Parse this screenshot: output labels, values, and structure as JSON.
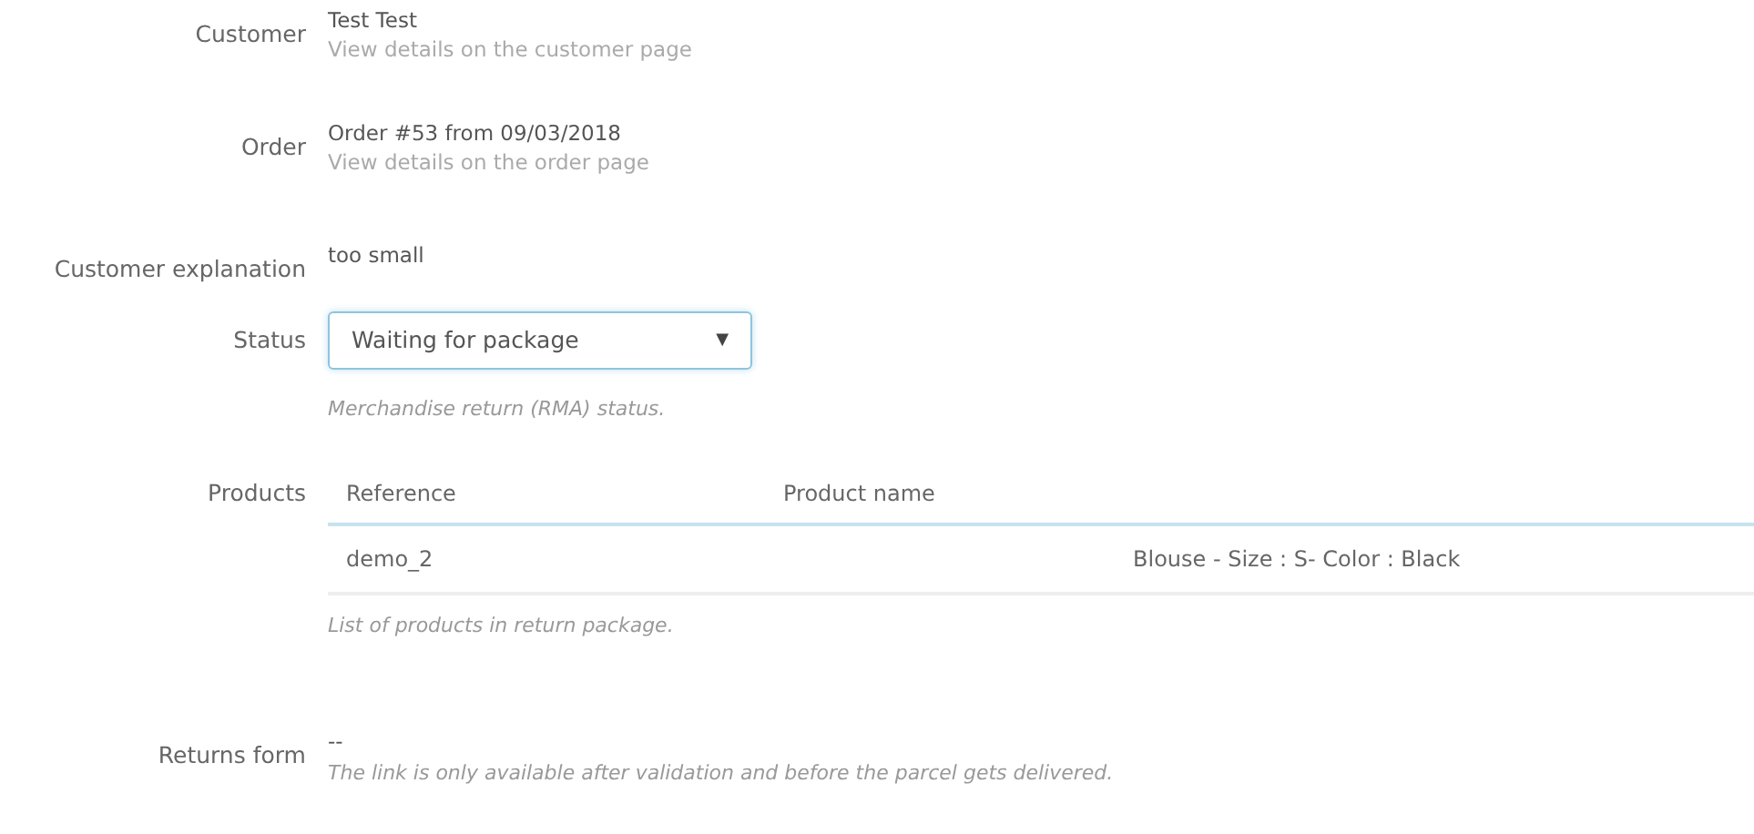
{
  "customer": {
    "label": "Customer",
    "name": "Test Test",
    "link": "View details on the customer page"
  },
  "order": {
    "label": "Order",
    "name": "Order #53 from 09/03/2018",
    "link": "View details on the order page"
  },
  "explanation": {
    "label": "Customer explanation",
    "value": "too small"
  },
  "status": {
    "label": "Status",
    "value": "Waiting for package",
    "caret": "▼",
    "help": "Merchandise return (RMA) status."
  },
  "products": {
    "label": "Products",
    "columns": [
      "Reference",
      "Product name"
    ],
    "rows": [
      {
        "reference": "demo_2",
        "product_name": "Blouse - Size : S- Color : Black"
      }
    ],
    "help": "List of products in return package."
  },
  "returns_form": {
    "label": "Returns form",
    "value": "--",
    "help": "The link is only available after validation and before the parcel gets delivered."
  }
}
